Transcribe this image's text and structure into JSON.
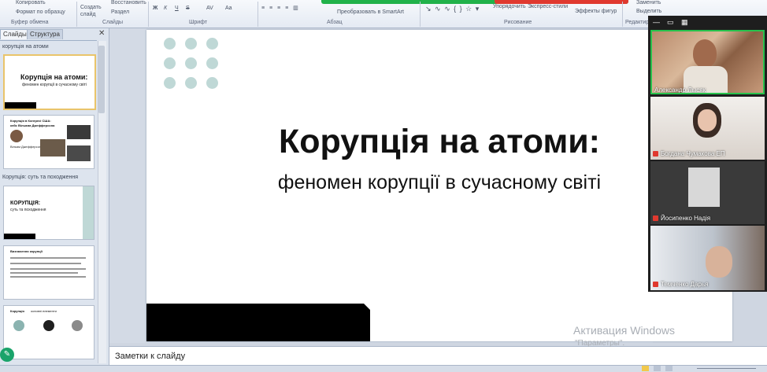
{
  "ribbon": {
    "clipboard": {
      "copy": "Копировать",
      "format_painter": "Формат по образцу",
      "group": "Буфер обмена"
    },
    "slides": {
      "new_slide": "Создать слайд",
      "restore": "Восстановить",
      "section": "Раздел",
      "group": "Слайды"
    },
    "font": {
      "group": "Шрифт",
      "bold": "Ж",
      "italic": "К",
      "underline": "Ч",
      "strike": "S",
      "spacing": "AV",
      "case": "Aa"
    },
    "paragraph": {
      "group": "Абзац",
      "smartart": "Преобразовать в SmartArt"
    },
    "drawing": {
      "group": "Рисование",
      "arrange": "Упорядочить",
      "quick_styles": "Экспресс-стили",
      "shape_effects": "Эффекты фигур"
    },
    "editing": {
      "group": "Редактир",
      "replace": "Заменить",
      "select": "Выделить"
    }
  },
  "left_pane": {
    "tabs": [
      "Слайды",
      "Структура"
    ],
    "sections": [
      "корупція на атоми",
      "Корупція: суть та походження"
    ],
    "thumbs": [
      {
        "title": "Корупція на атоми:",
        "subtitle": "феномен корупції в сучасному світі"
      },
      {
        "title": "Корупція в Конгресі США: кейс Вільяма Джефферсона",
        "subtitle": "Вільям Джефферсон"
      },
      {
        "title": "КОРУПЦІЯ:",
        "subtitle": "суть та походження"
      },
      {
        "title": "Визначення корупції",
        "subtitle": ""
      },
      {
        "title": "Корупція",
        "subtitle": "основні елементи"
      }
    ]
  },
  "slide": {
    "title": "Корупція на атоми:",
    "subtitle": "феномен корупції в сучасному світі"
  },
  "watermark": {
    "line1": "Активация Windows",
    "line2": "\"Параметры\"."
  },
  "notes": {
    "label": "Заметки к слайду"
  },
  "video": {
    "participants": [
      {
        "name": "Александр Лысяк",
        "muted": false,
        "active": true
      },
      {
        "name": "Богдана Чумакова ЕП",
        "muted": true,
        "active": false
      },
      {
        "name": "Йосипенко Надія",
        "muted": true,
        "active": false
      },
      {
        "name": "Темченко Дарья",
        "muted": true,
        "active": false
      }
    ]
  },
  "colors": {
    "accent_border": "#27c24c",
    "mute": "#e0392f",
    "dot": "#bfd8d6"
  }
}
